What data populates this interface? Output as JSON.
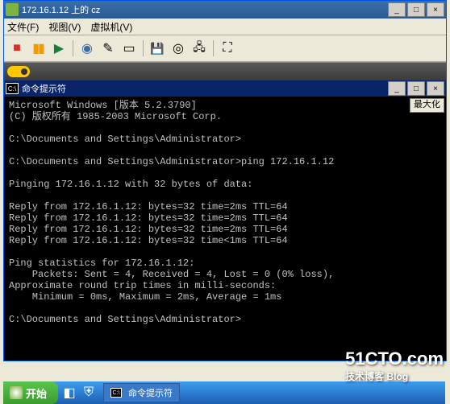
{
  "outer_window": {
    "title": "172.16.1.12 上的 cz",
    "btn_min": "_",
    "btn_max": "□",
    "btn_close": "×"
  },
  "menu": {
    "file": "文件(F)",
    "view": "视图(V)",
    "vm": "虚拟机(V)"
  },
  "dark_header": {},
  "cmd_window": {
    "title": "命令提示符",
    "maximize_label": "最大化"
  },
  "console_lines": [
    "Microsoft Windows [版本 5.2.3790]",
    "(C) 版权所有 1985-2003 Microsoft Corp.",
    "",
    "C:\\Documents and Settings\\Administrator>",
    "",
    "C:\\Documents and Settings\\Administrator>ping 172.16.1.12",
    "",
    "Pinging 172.16.1.12 with 32 bytes of data:",
    "",
    "Reply from 172.16.1.12: bytes=32 time=2ms TTL=64",
    "Reply from 172.16.1.12: bytes=32 time=2ms TTL=64",
    "Reply from 172.16.1.12: bytes=32 time=2ms TTL=64",
    "Reply from 172.16.1.12: bytes=32 time<1ms TTL=64",
    "",
    "Ping statistics for 172.16.1.12:",
    "    Packets: Sent = 4, Received = 4, Lost = 0 (0% loss),",
    "Approximate round trip times in milli-seconds:",
    "    Minimum = 0ms, Maximum = 2ms, Average = 1ms",
    "",
    "C:\\Documents and Settings\\Administrator>",
    ""
  ],
  "taskbar": {
    "start": "开始",
    "task_cmd": "命令提示符"
  },
  "watermark": {
    "main": "51CTO.com",
    "sub": "技术博客   Blog"
  },
  "icons": {
    "stop": "■",
    "pause": "▮▮",
    "play": "▶",
    "snap": "◉",
    "note": "✎",
    "window": "▭",
    "floppy": "💾",
    "cd": "◎",
    "net": "🖧",
    "full": "⛶",
    "cmd": "C:\\"
  },
  "colors": {
    "stop": "#d93025",
    "pause": "#f29900",
    "play": "#188038"
  }
}
